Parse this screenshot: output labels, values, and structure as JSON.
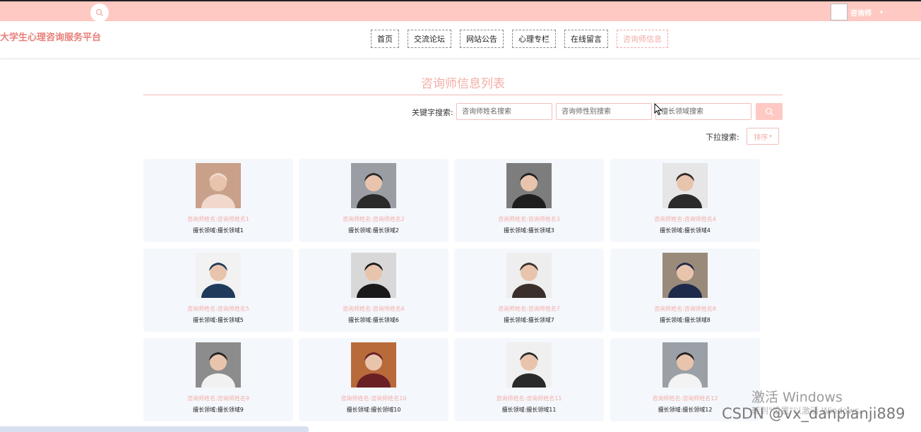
{
  "topbar": {
    "user_name": "咨询师",
    "caret": "▾"
  },
  "header": {
    "site_title": "大学生心理咨询服务平台",
    "nav": [
      "首页",
      "交流论坛",
      "网站公告",
      "心理专栏",
      "在线留言",
      "咨询师信息"
    ],
    "active_index": 5
  },
  "page": {
    "title": "咨询师信息列表",
    "keyword_label": "关键字搜索:",
    "placeholders": {
      "name": "咨询师姓名搜索",
      "gender": "咨询师性别搜索",
      "field": "擅长领域搜索"
    },
    "dropdown_label": "下拉搜索:",
    "sort_label": "排序",
    "sort_caret": "▾"
  },
  "counselors": [
    {
      "name": "咨询师姓名:咨询师姓名1",
      "field": "擅长领域:擅长领域1",
      "photo": "young woman portrait",
      "bg": "#c9a08a",
      "fg": "#f0d9cc"
    },
    {
      "name": "咨询师姓名:咨询师姓名2",
      "field": "擅长领域:擅长领域2",
      "photo": "young man portrait",
      "bg": "#9a9ea4",
      "fg": "#2a2a2a"
    },
    {
      "name": "咨询师姓名:咨询师姓名3",
      "field": "擅长领域:擅长领域3",
      "photo": "woman portrait",
      "bg": "#7d7d7d",
      "fg": "#1e1e1e"
    },
    {
      "name": "咨询师姓名:咨询师姓名4",
      "field": "擅长领域:擅长领域4",
      "photo": "woman in suit portrait",
      "bg": "#e6e6e6",
      "fg": "#2b2b2b"
    },
    {
      "name": "咨询师姓名:咨询师姓名5",
      "field": "擅长领域:擅长领域5",
      "photo": "man in suit poster",
      "bg": "#f2f2f2",
      "fg": "#1f3a5a"
    },
    {
      "name": "咨询师姓名:咨询师姓名6",
      "field": "擅长领域:擅长领域6",
      "photo": "man at desk portrait",
      "bg": "#d8d8d8",
      "fg": "#1a1a1a"
    },
    {
      "name": "咨询师姓名:咨询师姓名7",
      "field": "擅长领域:擅长领域7",
      "photo": "young man portrait",
      "bg": "#eeeeee",
      "fg": "#3a2f2a"
    },
    {
      "name": "咨询师姓名:咨询师姓名8",
      "field": "擅长领域:擅长领域8",
      "photo": "young man portrait",
      "bg": "#9a8a7a",
      "fg": "#1d2a4a"
    },
    {
      "name": "咨询师姓名:咨询师姓名9",
      "field": "擅长领域:擅长领域9",
      "photo": "woman portrait",
      "bg": "#8c8c8c",
      "fg": "#f1f1f1"
    },
    {
      "name": "咨询师姓名:咨询师姓名10",
      "field": "擅长领域:擅长领域10",
      "photo": "man with glasses portrait",
      "bg": "#b86a3a",
      "fg": "#6a1f25"
    },
    {
      "name": "咨询师姓名:咨询师姓名11",
      "field": "擅长领域:擅长领域11",
      "photo": "woman portrait",
      "bg": "#f0f0f0",
      "fg": "#2a2a2a"
    },
    {
      "name": "咨询师姓名:咨询师姓名12",
      "field": "擅长领域:擅长领域12",
      "photo": "woman portrait",
      "bg": "#9aa0a6",
      "fg": "#f3f3f3"
    }
  ],
  "watermark": {
    "activate_title": "激活 Windows",
    "activate_sub": "转到\"设置\"以激活 Windows。",
    "csdn": "CSDN @vx_danpianji889"
  },
  "colors": {
    "topbar": "#ffc9c3",
    "accent": "#f4aca6",
    "card": "#f4f7fc"
  }
}
